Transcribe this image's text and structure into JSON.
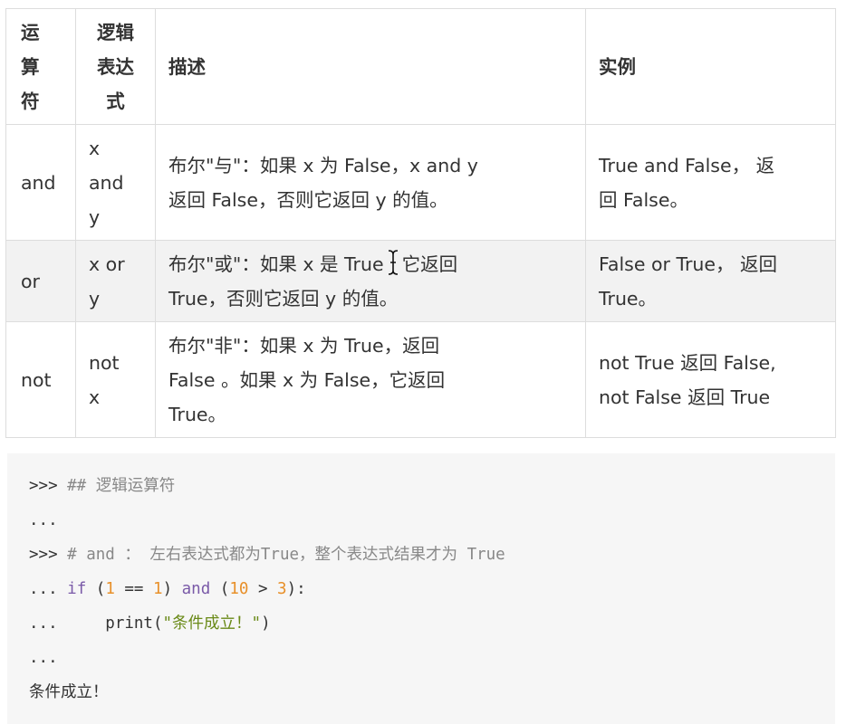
{
  "table": {
    "headers": [
      "运\n算\n符",
      "逻辑\n表达\n式",
      "描述",
      "实例"
    ],
    "rows": [
      {
        "operator": "and",
        "expression": "x\nand\ny",
        "description": "布尔\"与\"：如果 x 为 False，x and y\n返回 False，否则它返回 y 的值。",
        "example": "True and False， 返\n回 False。"
      },
      {
        "operator": "or",
        "expression": "x or\ny",
        "description_pre": "布尔\"或\"：如果 x 是 True",
        "description_post": "它返回\nTrue，否则它返回 y 的值。",
        "example": "False or True， 返回\nTrue。"
      },
      {
        "operator": "not",
        "expression": "not\nx",
        "description": "布尔\"非\"：如果 x 为 True，返回\nFalse 。如果 x 为 False，它返回\nTrue。",
        "example": "not True 返回 False,\nnot False 返回 True"
      }
    ]
  },
  "code": {
    "line1_prompt": ">>>",
    "line1_comment": " ## 逻辑运算符",
    "line2": "...",
    "line3_prompt": ">>>",
    "line3_comment": " # and ： 左右表达式都为True，整个表达式结果才为 True",
    "line4_prompt": "...",
    "line4_kw_if": "if",
    "line4_p1": " (",
    "line4_n1": "1",
    "line4_eq": " == ",
    "line4_n2": "1",
    "line4_p2": ") ",
    "line4_kw_and": "and",
    "line4_p3": " (",
    "line4_n3": "10",
    "line4_gt": " > ",
    "line4_n4": "3",
    "line4_p4": "):",
    "line5_prompt": "...",
    "line5_call": "     print(",
    "line5_str": "\"条件成立！\"",
    "line5_close": ")",
    "line6": "...",
    "line7": "条件成立！"
  },
  "icons": {
    "cursor": "text-cursor-icon"
  }
}
